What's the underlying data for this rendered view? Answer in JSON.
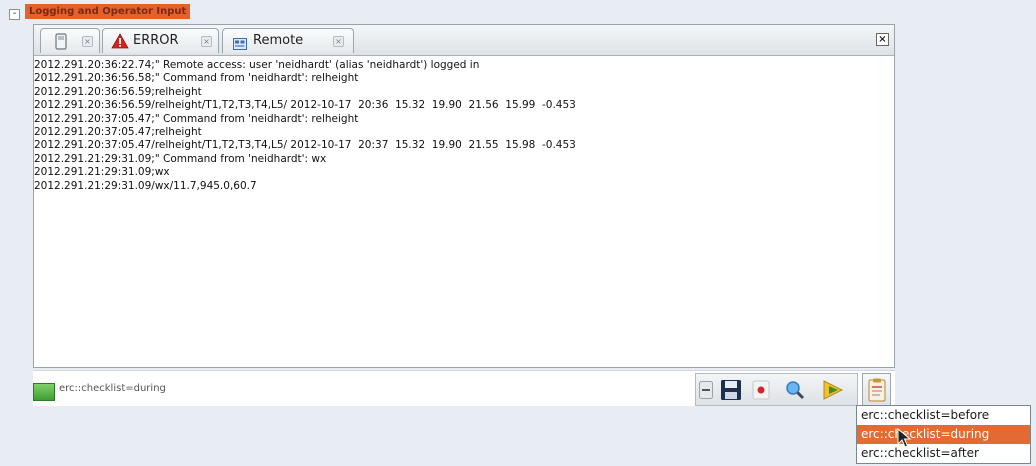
{
  "panel": {
    "toggle": "-",
    "title": "Logging and Operator Input"
  },
  "tabs": [
    {
      "label": "",
      "icon": "monitor-icon"
    },
    {
      "label": "ERROR",
      "icon": "warning-icon"
    },
    {
      "label": "Remote",
      "icon": "remote-icon"
    }
  ],
  "log": {
    "lines": [
      "2012.291.20:36:22.74;\" Remote access: user 'neidhardt' (alias 'neidhardt') logged in",
      "2012.291.20:36:56.58;\" Command from 'neidhardt': relheight",
      "2012.291.20:36:56.59;relheight",
      "2012.291.20:36:56.59/relheight/T1,T2,T3,T4,L5/ 2012-10-17  20:36  15.32  19.90  21.56  15.99  -0.453",
      "2012.291.20:37:05.47;\" Command from 'neidhardt': relheight",
      "2012.291.20:37:05.47;relheight",
      "2012.291.20:37:05.47/relheight/T1,T2,T3,T4,L5/ 2012-10-17  20:37  15.32  19.90  21.55  15.98  -0.453",
      "2012.291.21:29:31.09;\" Command from 'neidhardt': wx",
      "2012.291.21:29:31.09;wx",
      "2012.291.21:29:31.09/wx/11.7,945.0,60.7"
    ]
  },
  "input": {
    "value": "erc::checklist=during"
  },
  "toolbar": {
    "buttons": [
      "minus-icon",
      "save-icon",
      "record-icon",
      "search-icon",
      "play-icon"
    ]
  },
  "dropdown": {
    "options": [
      "erc::checklist=before",
      "erc::checklist=during",
      "erc::checklist=after"
    ],
    "selected_index": 1
  },
  "colors": {
    "title_bg": "#e4612b",
    "selection": "#e46a33",
    "error_red": "#d8231d"
  }
}
